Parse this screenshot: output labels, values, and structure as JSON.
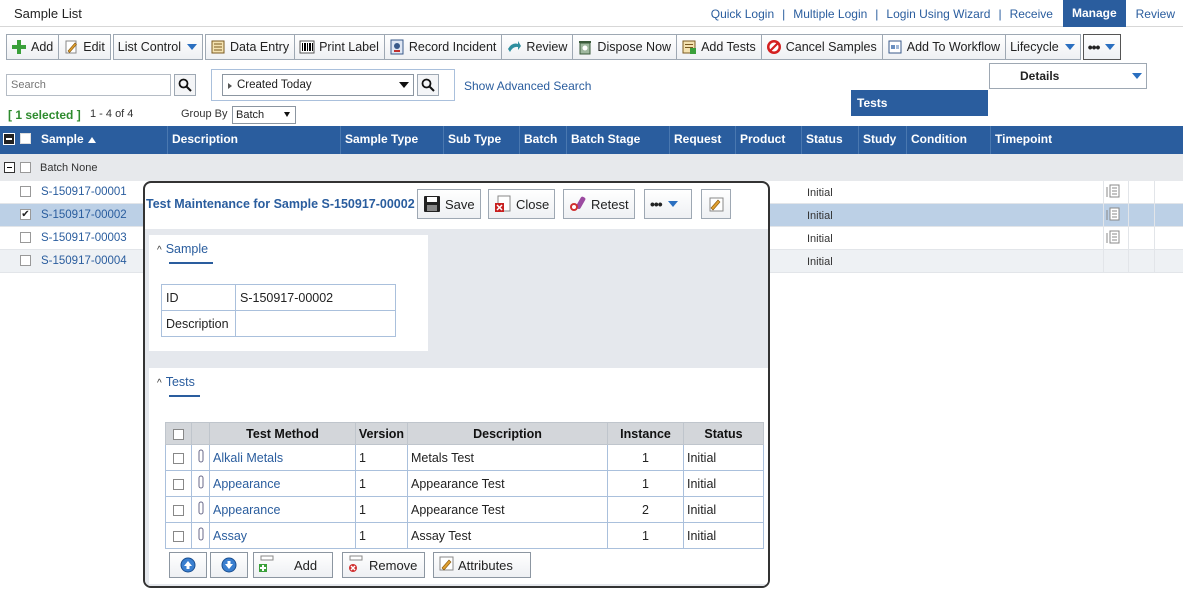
{
  "app": {
    "title": "Sample List"
  },
  "top_links": {
    "items": [
      "Quick Login",
      "Multiple Login",
      "Login Using Wizard",
      "Receive"
    ],
    "active": "Manage",
    "last": "Review"
  },
  "toolbar": {
    "add": "Add",
    "edit": "Edit",
    "list_control": "List Control",
    "data_entry": "Data Entry",
    "print_label": "Print Label",
    "record_incident": "Record Incident",
    "review": "Review",
    "dispose_now": "Dispose Now",
    "add_tests": "Add Tests",
    "cancel_samples": "Cancel Samples",
    "add_to_workflow": "Add To Workflow",
    "lifecycle": "Lifecycle",
    "more": "•••"
  },
  "search": {
    "placeholder": "Search"
  },
  "filter": {
    "selected": "Created Today",
    "advanced": "Show Advanced Search"
  },
  "list_info": {
    "selected": "[ 1 selected ]",
    "range": "1 - 4 of 4",
    "group_by_label": "Group By",
    "group_by_value": "Batch"
  },
  "grid": {
    "columns": [
      "Sample",
      "Description",
      "Sample Type",
      "Sub Type",
      "Batch",
      "Batch Stage",
      "Request",
      "Product",
      "Status",
      "Study",
      "Condition",
      "Timepoint"
    ],
    "group_label": "Batch None",
    "rows": [
      {
        "id": "S-150917-00001",
        "status": "Initial",
        "selected": false,
        "flag": true
      },
      {
        "id": "S-150917-00002",
        "status": "Initial",
        "selected": true,
        "flag": true
      },
      {
        "id": "S-150917-00003",
        "status": "Initial",
        "selected": false,
        "flag": true
      },
      {
        "id": "S-150917-00004",
        "status": "Initial",
        "selected": false,
        "flag": false
      }
    ]
  },
  "menu": {
    "details": "Details",
    "tests": "Tests"
  },
  "dialog": {
    "title": "Test Maintenance for Sample S-150917-00002",
    "buttons": {
      "save": "Save",
      "close": "Close",
      "retest": "Retest",
      "more": "•••"
    },
    "sample_section": {
      "heading": "Sample",
      "fields": [
        {
          "key": "ID",
          "value": "S-150917-00002"
        },
        {
          "key": "Description",
          "value": ""
        }
      ]
    },
    "tests_section": {
      "heading": "Tests",
      "columns": [
        "Test Method",
        "Version",
        "Description",
        "Instance",
        "Status"
      ],
      "rows": [
        {
          "method": "Alkali Metals",
          "version": "1",
          "description": "Metals Test",
          "instance": "1",
          "status": "Initial"
        },
        {
          "method": "Appearance",
          "version": "1",
          "description": "Appearance Test",
          "instance": "1",
          "status": "Initial"
        },
        {
          "method": "Appearance",
          "version": "1",
          "description": "Appearance Test",
          "instance": "2",
          "status": "Initial"
        },
        {
          "method": "Assay",
          "version": "1",
          "description": "Assay Test",
          "instance": "1",
          "status": "Initial"
        }
      ]
    },
    "bottom_buttons": {
      "add": "Add",
      "remove": "Remove",
      "attributes": "Attributes"
    }
  },
  "colors": {
    "accent": "#2a5d9e",
    "selected_row": "#bcd0e6",
    "group_row": "#e7e9ec"
  }
}
